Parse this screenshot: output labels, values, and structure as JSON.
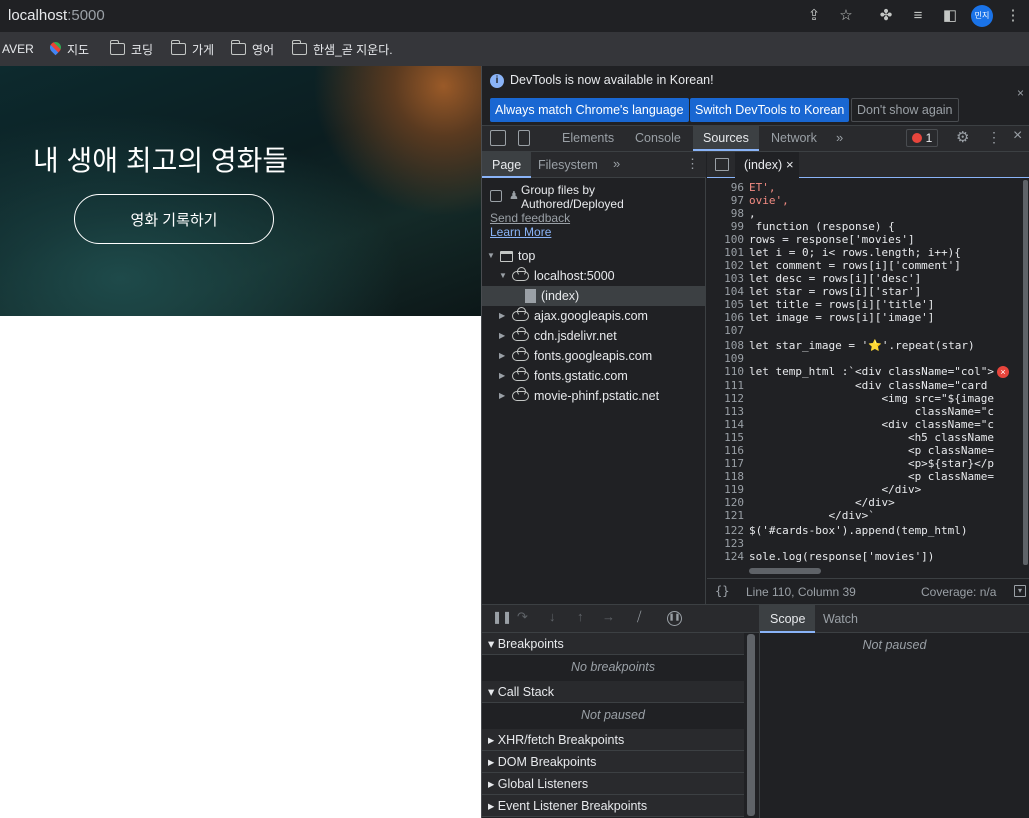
{
  "browser": {
    "url_host": "localhost",
    "url_port": ":5000",
    "profile_initials": "민지"
  },
  "bookmarks": [
    {
      "label": "AVER",
      "icon": "none"
    },
    {
      "label": "지도",
      "icon": "maps-pin-icon"
    },
    {
      "label": "코딩",
      "icon": "folder-icon"
    },
    {
      "label": "가게",
      "icon": "folder-icon"
    },
    {
      "label": "영어",
      "icon": "folder-icon"
    },
    {
      "label": "한샘_곧 지운다.",
      "icon": "folder-icon"
    }
  ],
  "page": {
    "title": "내 생애 최고의 영화들",
    "record_button": "영화 기록하기"
  },
  "devtools": {
    "info_message": "DevTools is now available in Korean!",
    "btn_match": "Always match Chrome's language",
    "btn_switch": "Switch DevTools to Korean",
    "btn_dont_show": "Don't show again",
    "tabs": [
      "Elements",
      "Console",
      "Sources",
      "Network"
    ],
    "active_tab": "Sources",
    "error_count": "1",
    "nav_tabs": [
      "Page",
      "Filesystem"
    ],
    "group_files_label": "Group files by Authored/Deployed",
    "send_feedback": "Send feedback",
    "learn_more": "Learn More",
    "tree": [
      {
        "label": "top",
        "depth": 0,
        "icon": "frame-icon",
        "expanded": true
      },
      {
        "label": "localhost:5000",
        "depth": 1,
        "icon": "cloud-icon",
        "expanded": true
      },
      {
        "label": "(index)",
        "depth": 2,
        "icon": "file-icon",
        "selected": true
      },
      {
        "label": "ajax.googleapis.com",
        "depth": 1,
        "icon": "cloud-icon"
      },
      {
        "label": "cdn.jsdelivr.net",
        "depth": 1,
        "icon": "cloud-icon"
      },
      {
        "label": "fonts.googleapis.com",
        "depth": 1,
        "icon": "cloud-icon"
      },
      {
        "label": "fonts.gstatic.com",
        "depth": 1,
        "icon": "cloud-icon"
      },
      {
        "label": "movie-phinf.pstatic.net",
        "depth": 1,
        "icon": "cloud-icon"
      }
    ],
    "editor_tab": "(index)",
    "code_lines": [
      {
        "n": "96",
        "text": "ET',"
      },
      {
        "n": "97",
        "text": "ovie',"
      },
      {
        "n": "98",
        "text": ","
      },
      {
        "n": "99",
        "text": " function (response) {"
      },
      {
        "n": "100",
        "text": "rows = response['movies']"
      },
      {
        "n": "101",
        "text": "let i = 0; i< rows.length; i++){"
      },
      {
        "n": "102",
        "text": "let comment = rows[i]['comment']"
      },
      {
        "n": "103",
        "text": "let desc = rows[i]['desc']"
      },
      {
        "n": "104",
        "text": "let star = rows[i]['star']"
      },
      {
        "n": "105",
        "text": "let title = rows[i]['title']"
      },
      {
        "n": "106",
        "text": "let image = rows[i]['image']"
      },
      {
        "n": "107",
        "text": ""
      },
      {
        "n": "108",
        "text": "let star_image = '⭐'.repeat(star)"
      },
      {
        "n": "109",
        "text": ""
      },
      {
        "n": "110",
        "text": "let temp_html :`<div className=\"col\">"
      },
      {
        "n": "111",
        "text": "                <div className=\"card"
      },
      {
        "n": "112",
        "text": "                    <img src=\"${image"
      },
      {
        "n": "113",
        "text": "                         className=\"c"
      },
      {
        "n": "114",
        "text": "                    <div className=\"c"
      },
      {
        "n": "115",
        "text": "                        <h5 className"
      },
      {
        "n": "116",
        "text": "                        <p className="
      },
      {
        "n": "117",
        "text": "                        <p>${star}</p"
      },
      {
        "n": "118",
        "text": "                        <p className="
      },
      {
        "n": "119",
        "text": "                    </div>"
      },
      {
        "n": "120",
        "text": "                </div>"
      },
      {
        "n": "121",
        "text": "            </div>`"
      },
      {
        "n": "122",
        "text": "$('#cards-box').append(temp_html)"
      },
      {
        "n": "123",
        "text": ""
      },
      {
        "n": "124",
        "text": "sole.log(response['movies'])"
      }
    ],
    "status_position": "Line 110, Column 39",
    "status_coverage": "Coverage: n/a",
    "debug_tabs": [
      "Scope",
      "Watch"
    ],
    "not_paused_scope": "Not paused",
    "sections": {
      "breakpoints": "Breakpoints",
      "no_breakpoints": "No breakpoints",
      "call_stack": "Call Stack",
      "not_paused": "Not paused",
      "xhr": "XHR/fetch Breakpoints",
      "dom": "DOM Breakpoints",
      "global": "Global Listeners",
      "event": "Event Listener Breakpoints"
    }
  }
}
